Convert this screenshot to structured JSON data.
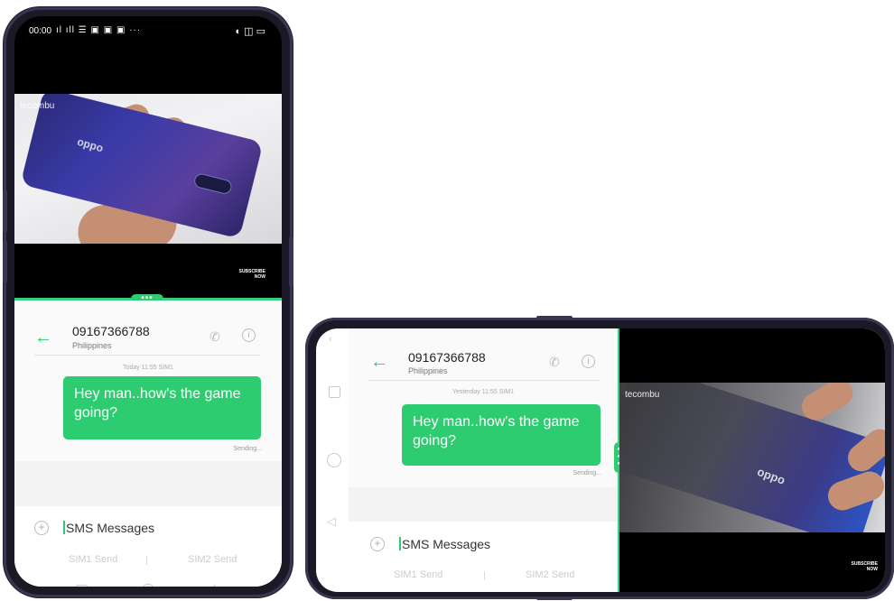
{
  "portrait": {
    "status_time": "00:00",
    "status_icons_left": "ıl ıll ☰ ▣ ▣ ▣ ···",
    "status_icons_right": "◐ ◫ ▭",
    "video_watermark": "tecombu",
    "subscribe_line1": "SUBSCRIBE",
    "subscribe_line2": "NOW",
    "handle_dots": "•••",
    "contact_number": "09167366788",
    "contact_country": "Philippines",
    "timestamp": "Today 11:55  SIM1",
    "message_text": "Hey man..how's the game going?",
    "status_sending": "Sending...",
    "input_placeholder": "SMS Messages",
    "sim1_label": "SIM1 Send",
    "sim2_label": "SIM2 Send",
    "nav_back_glyph": "⌄"
  },
  "landscape": {
    "contact_number": "09167366788",
    "contact_country": "Philippines",
    "timestamp": "Yesterday 11:55  SIM1",
    "message_text": "Hey man..how's the game going?",
    "status_sending": "Sending...",
    "input_placeholder": "SMS Messages",
    "sim1_label": "SIM1 Send",
    "sim2_label": "SIM2 Send",
    "video_watermark": "tecombu",
    "subscribe_line1": "SUBSCRIBE",
    "subscribe_line2": "NOW",
    "handle_dots": "•••"
  },
  "icons": {
    "back": "arrow-left-icon",
    "call": "phone-icon",
    "info": "info-icon",
    "add": "plus-circle-icon"
  },
  "colors": {
    "accent": "#2ecc71",
    "frame": "#1a1a26",
    "video_bg": "#000000"
  }
}
